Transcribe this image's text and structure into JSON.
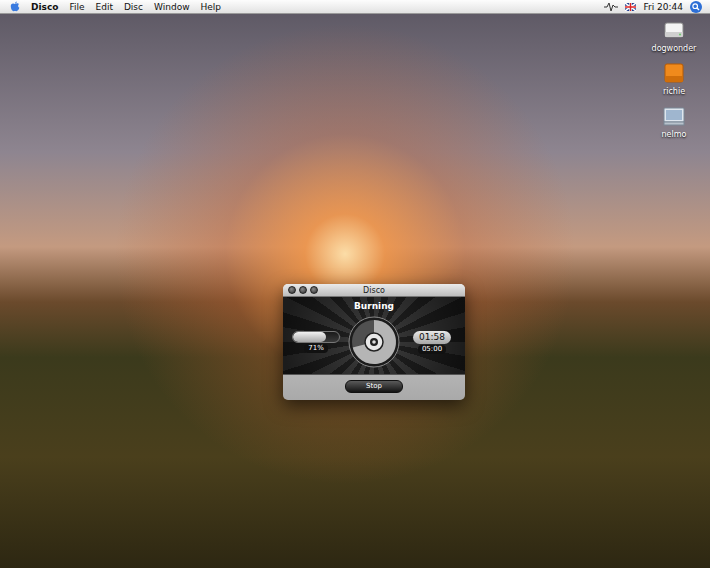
{
  "menubar": {
    "app": "Disco",
    "menus": [
      "File",
      "Edit",
      "Disc",
      "Window",
      "Help"
    ],
    "clock": "Fri 20:44"
  },
  "desktop_icons": [
    {
      "label": "dogwonder",
      "kind": "drive"
    },
    {
      "label": "richie",
      "kind": "external"
    },
    {
      "label": "nelmo",
      "kind": "network"
    }
  ],
  "window": {
    "title": "Disco",
    "status": "Burning",
    "progress": {
      "level": 0.71,
      "reading": "71%"
    },
    "elapsed": "01:58",
    "total": "05:00",
    "buttons": [
      "Stop"
    ]
  }
}
